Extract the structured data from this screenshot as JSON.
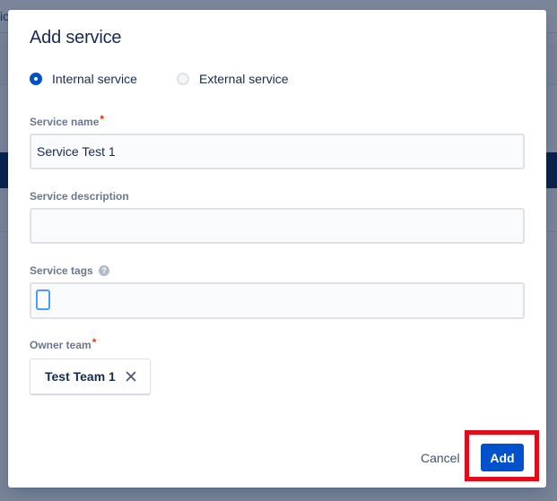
{
  "background": {
    "topbar_partial_text": "ic"
  },
  "modal": {
    "title": "Add service",
    "service_type": {
      "options": [
        {
          "label": "Internal service",
          "selected": true
        },
        {
          "label": "External service",
          "selected": false
        }
      ]
    },
    "fields": {
      "service_name": {
        "label": "Service name",
        "required_marker": "*",
        "value": "Service Test 1"
      },
      "service_description": {
        "label": "Service description",
        "value": ""
      },
      "service_tags": {
        "label": "Service tags",
        "help_icon_glyph": "?",
        "value": ""
      },
      "owner_team": {
        "label": "Owner team",
        "required_marker": "*",
        "selected_team": "Test Team 1"
      }
    },
    "footer": {
      "cancel_label": "Cancel",
      "add_label": "Add"
    }
  },
  "colors": {
    "primary": "#0052cc",
    "highlight": "#e20b17",
    "required": "#de350b",
    "overlay": "rgba(9, 30, 66, 0.54)"
  },
  "icons": {
    "chip_remove": "close-icon",
    "tags_help": "question-circle-icon"
  }
}
